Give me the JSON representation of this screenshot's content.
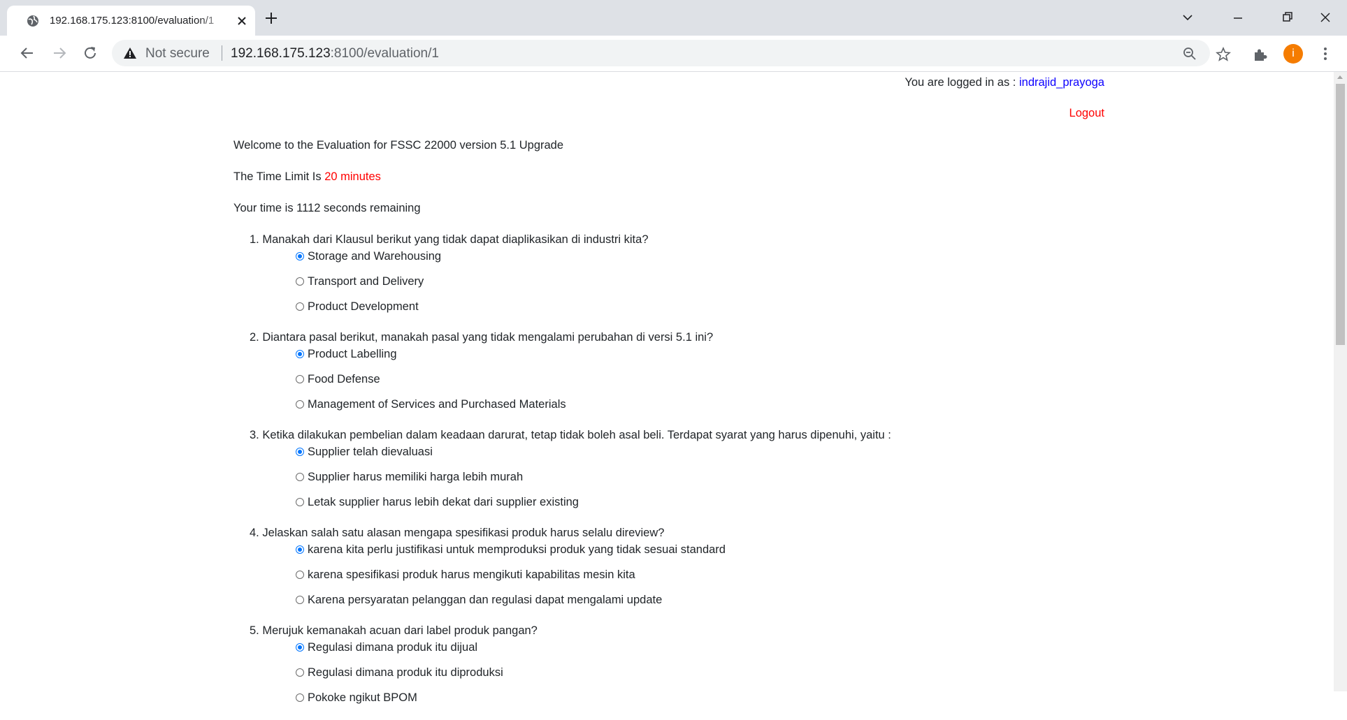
{
  "browser": {
    "tab_title": "192.168.175.123:8100/evaluation/1",
    "security_label": "Not secure",
    "url_host": "192.168.175.123",
    "url_rest": ":8100/evaluation/1",
    "profile_initial": "i",
    "profile_color": "#f57c00"
  },
  "header": {
    "login_prefix": "You are logged in as : ",
    "username": "indrajid_prayoga",
    "logout_label": "Logout"
  },
  "intro": {
    "welcome": "Welcome to the Evaluation for FSSC 22000 version 5.1 Upgrade",
    "time_limit_prefix": "The Time Limit Is ",
    "time_limit_value": "20 minutes",
    "remaining": "Your time is 1112 seconds remaining"
  },
  "questions": [
    {
      "text": "1. Manakah dari Klausul berikut yang tidak dapat diaplikasikan di industri kita?",
      "options": [
        {
          "label": "Storage and Warehousing",
          "checked": true
        },
        {
          "label": "Transport and Delivery",
          "checked": false
        },
        {
          "label": "Product Development",
          "checked": false
        }
      ]
    },
    {
      "text": "2. Diantara pasal berikut, manakah pasal yang tidak mengalami perubahan di versi 5.1 ini?",
      "options": [
        {
          "label": "Product Labelling",
          "checked": true
        },
        {
          "label": "Food Defense",
          "checked": false
        },
        {
          "label": "Management of Services and Purchased Materials",
          "checked": false
        }
      ]
    },
    {
      "text": "3. Ketika dilakukan pembelian dalam keadaan darurat, tetap tidak boleh asal beli. Terdapat syarat yang harus dipenuhi, yaitu :",
      "options": [
        {
          "label": "Supplier telah dievaluasi",
          "checked": true
        },
        {
          "label": "Supplier harus memiliki harga lebih murah",
          "checked": false
        },
        {
          "label": "Letak supplier harus lebih dekat dari supplier existing",
          "checked": false
        }
      ]
    },
    {
      "text": "4. Jelaskan salah satu alasan mengapa spesifikasi produk harus selalu direview?",
      "options": [
        {
          "label": "karena kita perlu justifikasi untuk memproduksi produk yang tidak sesuai standard",
          "checked": true
        },
        {
          "label": "karena spesifikasi produk harus mengikuti kapabilitas mesin kita",
          "checked": false
        },
        {
          "label": "Karena persyaratan pelanggan dan regulasi dapat mengalami update",
          "checked": false
        }
      ]
    },
    {
      "text": "5. Merujuk kemanakah acuan dari label produk pangan?",
      "options": [
        {
          "label": "Regulasi dimana produk itu dijual",
          "checked": true
        },
        {
          "label": "Regulasi dimana produk itu diproduksi",
          "checked": false
        },
        {
          "label": "Pokoke ngikut BPOM",
          "checked": false
        }
      ]
    }
  ]
}
